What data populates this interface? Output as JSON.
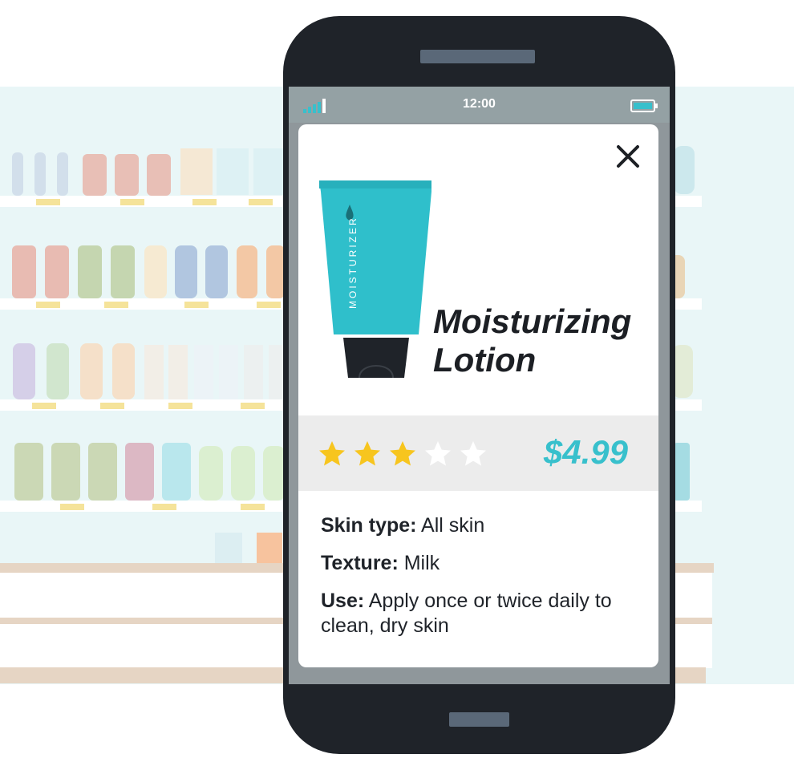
{
  "status_bar": {
    "time": "12:00",
    "signal_icon": "signal-icon",
    "battery_icon": "battery-icon"
  },
  "product": {
    "tube_label": "MOISTURIZER",
    "title_line1": "Moisturizing",
    "title_line2": "Lotion",
    "rating": 3,
    "rating_max": 5,
    "price": "$4.99",
    "specs": [
      {
        "label": "Skin type:",
        "value": "All skin"
      },
      {
        "label": "Texture:",
        "value": "Milk"
      },
      {
        "label": "Use:",
        "value": "Apply once or twice daily to clean, dry skin"
      }
    ]
  },
  "icons": {
    "close": "close-icon",
    "star_filled": "star-filled-icon",
    "star_empty": "star-empty-icon"
  },
  "colors": {
    "accent": "#38c0cc",
    "star": "#f7c51e",
    "phone": "#1f2329"
  }
}
